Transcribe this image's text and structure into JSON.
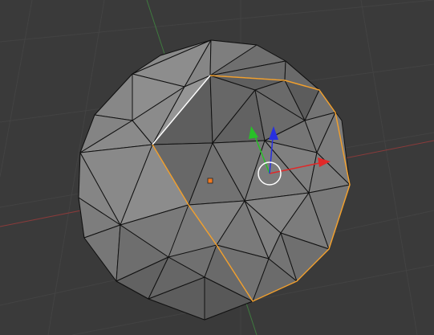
{
  "viewport": {
    "background": "#3a3a3a",
    "grid_color": "#434343",
    "x_axis_color": "#8a3a3a",
    "y_axis_color": "#3f7a3f"
  },
  "mesh": {
    "name": "icosphere",
    "face_color": "#7b7b7b",
    "selected_face_color": "#737373",
    "edge_color": "#111111",
    "selected_edge_color": "#f0a030",
    "highlight_edge_color": "#ffffff"
  },
  "gizmo": {
    "x_color": "#e02828",
    "y_color": "#28c028",
    "z_color": "#2830e0",
    "center_ring_color": "#ffffff"
  },
  "origin_color": "#f07820"
}
